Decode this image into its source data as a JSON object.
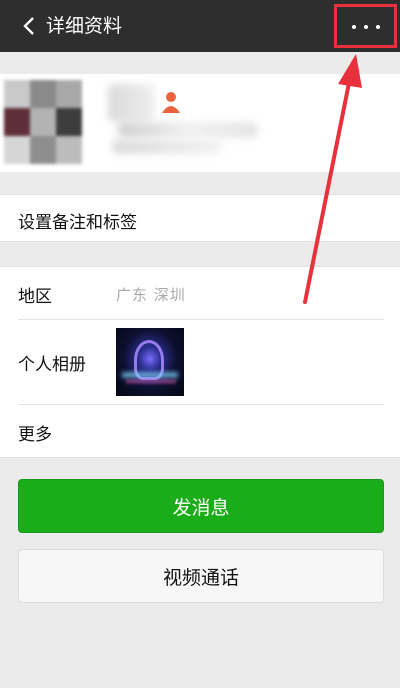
{
  "header": {
    "title": "详细资料",
    "back_icon": "chevron-left-icon",
    "more_icon": "more-dots-icon"
  },
  "profile": {
    "gender_icon": "person-female-icon",
    "gender_color": "#e8643c"
  },
  "remarks_row": {
    "label": "设置备注和标签"
  },
  "region_row": {
    "label": "地区",
    "value": "广东  深圳"
  },
  "album_row": {
    "label": "个人相册"
  },
  "more_row": {
    "label": "更多"
  },
  "buttons": {
    "send_message": "发消息",
    "video_call": "视频通话"
  },
  "colors": {
    "header_bg": "#2e2e2e",
    "primary_green": "#1aad19",
    "annotation_red": "#e8313c"
  }
}
